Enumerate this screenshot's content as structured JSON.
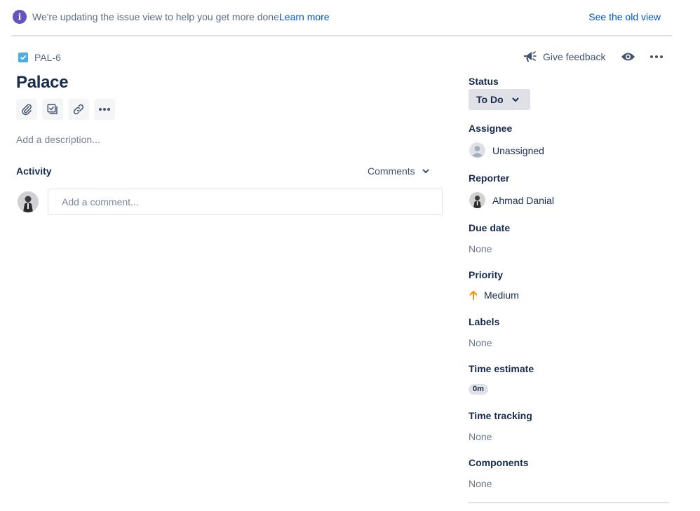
{
  "banner": {
    "message": "We're updating the issue view to help you get more done.",
    "learn_more": "Learn more",
    "old_view": "See the old view"
  },
  "issue": {
    "key": "PAL-6",
    "title": "Palace",
    "description_placeholder": "Add a description..."
  },
  "activity": {
    "label": "Activity",
    "filter": "Comments",
    "comment_placeholder": "Add a comment..."
  },
  "header_actions": {
    "feedback": "Give feedback"
  },
  "fields": {
    "status": {
      "label": "Status",
      "value": "To Do"
    },
    "assignee": {
      "label": "Assignee",
      "value": "Unassigned"
    },
    "reporter": {
      "label": "Reporter",
      "value": "Ahmad Danial"
    },
    "due_date": {
      "label": "Due date",
      "value": "None"
    },
    "priority": {
      "label": "Priority",
      "value": "Medium"
    },
    "labels": {
      "label": "Labels",
      "value": "None"
    },
    "time_estimate": {
      "label": "Time estimate",
      "value": "0m"
    },
    "time_tracking": {
      "label": "Time tracking",
      "value": "None"
    },
    "components": {
      "label": "Components",
      "value": "None"
    }
  },
  "colors": {
    "link": "#0052cc",
    "info_icon": "#6554c0",
    "issue_type": "#4bade8",
    "priority_medium": "#ff8b00"
  },
  "icons": {
    "info": "info-icon",
    "issue_type": "task-checkbox-icon",
    "attach": "paperclip-icon",
    "subtask": "subtask-icon",
    "link": "link-icon",
    "more": "more-icon",
    "feedback": "megaphone-icon",
    "watch": "eye-icon",
    "priority": "arrow-up-icon"
  }
}
